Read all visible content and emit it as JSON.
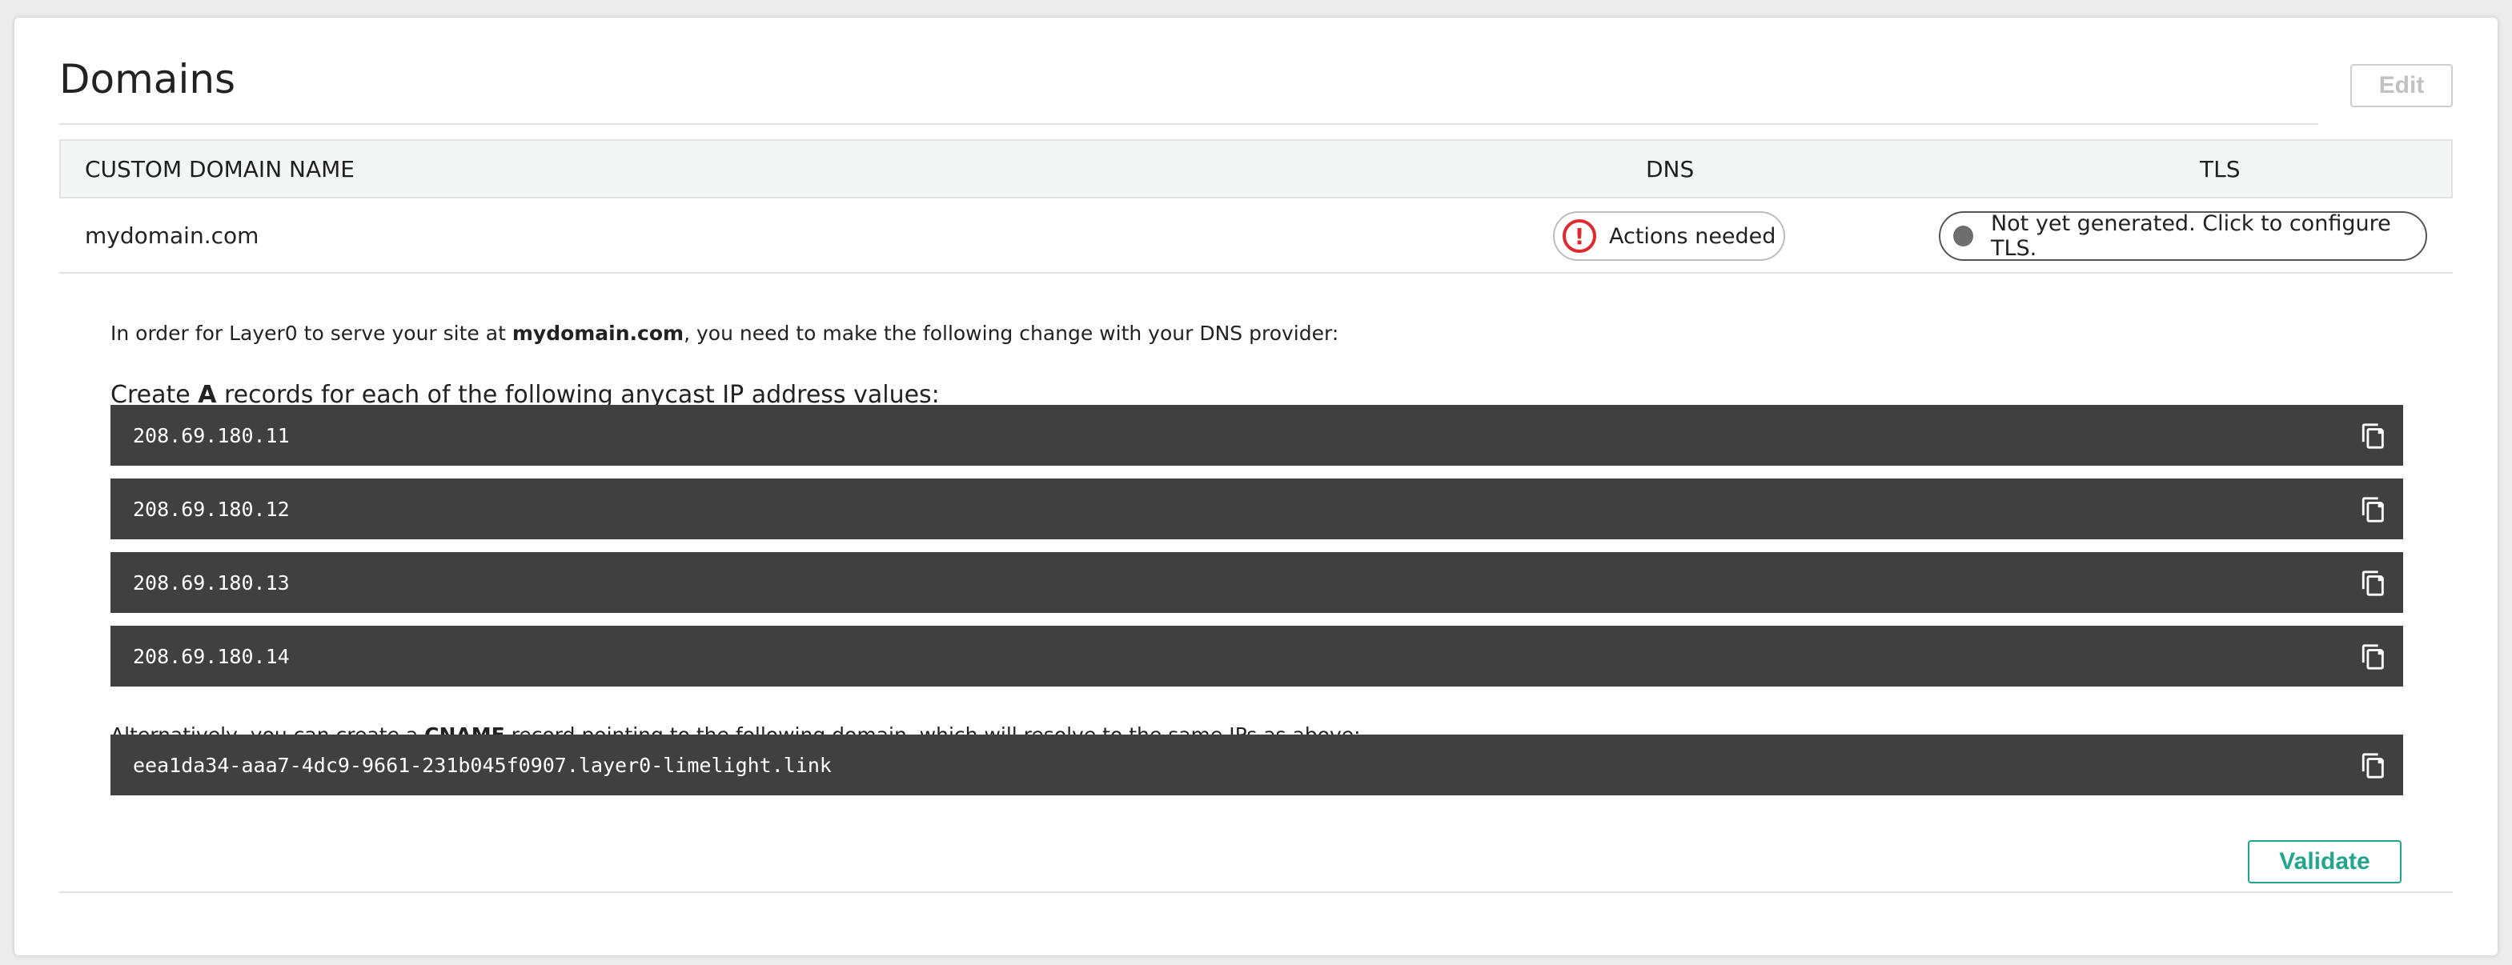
{
  "panel": {
    "title": "Domains",
    "edit_label": "Edit"
  },
  "table": {
    "columns": [
      "CUSTOM DOMAIN NAME",
      "DNS",
      "TLS"
    ],
    "row": {
      "domain": "mydomain.com",
      "dns_status": "Actions needed",
      "tls_status": "Not yet generated. Click to configure TLS."
    }
  },
  "instructions": {
    "intro_prefix": "In order for Layer0 to serve your site at ",
    "intro_domain": "mydomain.com",
    "intro_suffix": ", you need to make the following change with your DNS provider:",
    "a_prefix": "Create ",
    "a_bold": "A",
    "a_suffix": " records for each of the following anycast IP address values:",
    "ips": [
      "208.69.180.11",
      "208.69.180.12",
      "208.69.180.13",
      "208.69.180.14"
    ],
    "alt_prefix": "Alternatively, you can create a ",
    "alt_bold": "CNAME",
    "alt_suffix": " record pointing to the following domain, which will resolve to the same IPs as above:",
    "cname": "eea1da34-aaa7-4dc9-9661-231b045f0907.layer0-limelight.link"
  },
  "actions": {
    "validate_label": "Validate"
  },
  "colors": {
    "accent": "#21a58c",
    "warning": "#e0292f",
    "code_bg": "#404040"
  },
  "icons": {
    "dns_status": "exclamation-circle-icon",
    "tls_status": "grey-dot-icon",
    "copy": "copy-icon"
  }
}
